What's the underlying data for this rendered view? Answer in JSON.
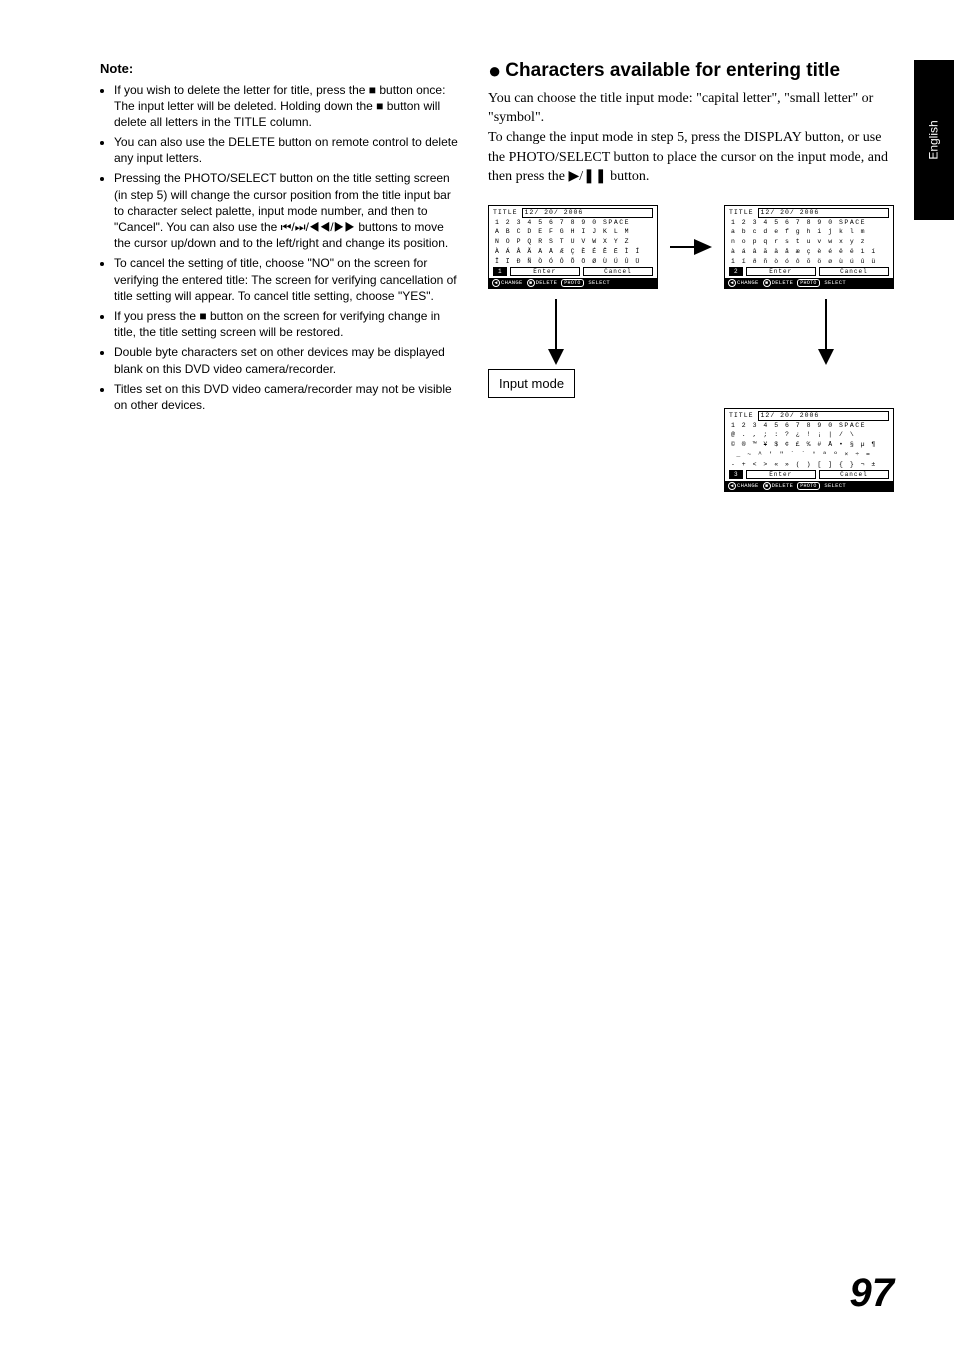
{
  "sideTab": "English",
  "pageNumber": "97",
  "left": {
    "noteHead": "Note:",
    "items": [
      "If you wish to delete the letter for title, press the ■ button once: The input letter will be deleted. Holding down the ■ button will delete all letters in the TITLE column.",
      "You can also use the DELETE button on remote control to delete any input letters.",
      "Pressing the PHOTO/SELECT button on the title setting screen (in step 5) will change the cursor position from the title input bar to character select palette, input mode number, and then to \"Cancel\". You can also use the ⏮/⏭/◀◀/▶▶ buttons to move the cursor up/down and to the left/right and change its position.",
      "To cancel the setting of title, choose \"NO\" on the screen for verifying the entered title: The screen for verifying cancellation of title setting will appear. To cancel title setting, choose \"YES\".",
      "If you press the ■ button on the screen for verifying change in title, the title setting screen will be restored.",
      "Double byte characters set on other devices may be displayed blank on this DVD video camera/recorder.",
      "Titles set on this DVD video camera/recorder may not be visible on other devices."
    ]
  },
  "right": {
    "heading": "Characters available for entering title",
    "body": "You can choose the title input mode: \"capital letter\", \"small letter\" or \"symbol\".\nTo change the input mode in step 5, press the DISPLAY button, or use the PHOTO/SELECT button to place the cursor on the input mode, and then press the ▶/❚❚ button.",
    "inputModeLabel": "Input mode"
  },
  "screens": {
    "titleLabel": "TITLE",
    "titleValue": "12/ 20/ 2006",
    "enter": "Enter",
    "cancel": "Cancel",
    "footer": {
      "change": "CHANGE",
      "delete": "DELETE",
      "photo": "PHOTO",
      "select": "SELECT"
    },
    "upper": {
      "mode": "1",
      "rows": [
        "1 2 3 4 5 6 7 8 9 0 SPACE",
        "A B C D E F G H I J K L M",
        "N O P Q R S T U V W X Y Z",
        "À Á Â Ã Ä Å Æ Ç È É Ê Ë Ì Í",
        "Î Ï Ð Ñ Ò Ó Ô Õ Ö Ø Ù Ú Û Ü"
      ]
    },
    "lower": {
      "mode": "2",
      "rows": [
        "1 2 3 4 5 6 7 8 9 0 SPACE",
        "a b c d e f g h i j k l m",
        "n o p q r s t u v w x y z",
        "à á â ã ä å æ ç è é ê ë ì í",
        "î ï ð ñ ò ó ô õ ö ø ù ú û ü"
      ]
    },
    "symbol": {
      "mode": "3",
      "rows": [
        "1 2 3 4 5 6 7 8 9 0 SPACE",
        "@ . , ; : ? ¿ ! ¡ | / \\",
        "© ® ™ ¥ $ ¢ £ % # Å • § µ ¶",
        " _ ~ ^ ' \" ` ´ ° ª º × ÷ =",
        "- + < > « » ( ) [ ] { } ¬ ±"
      ]
    }
  }
}
